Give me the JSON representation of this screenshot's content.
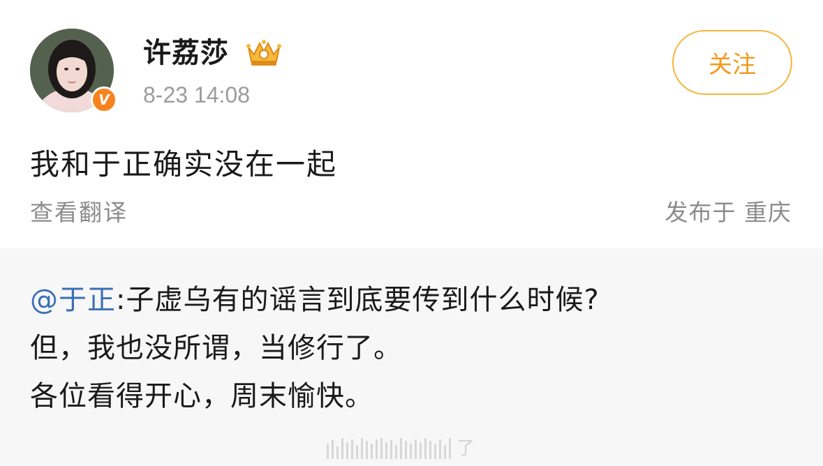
{
  "post": {
    "author": {
      "name": "许荔莎",
      "crown_icon": "crown-badge-icon",
      "verified_icon": "verified-v-icon",
      "verified_letter": "V",
      "verified_color": "#f7831e"
    },
    "timestamp": "8-23 14:08",
    "follow_label": "关注",
    "text": "我和于正确实没在一起",
    "translate_label": "查看翻译",
    "location": "发布于 重庆"
  },
  "repost": {
    "mention": "@于正",
    "lines": [
      ":子虚乌有的谣言到底要传到什么时候?",
      "但，我也没所谓，当修行了。",
      "各位看得开心，周末愉快。"
    ],
    "watermark_char": "了"
  },
  "colors": {
    "accent_orange": "#f19b1c",
    "link_blue": "#3b6fb6",
    "muted_gray": "#8c8c8c",
    "repost_bg": "#f7f7f7"
  }
}
